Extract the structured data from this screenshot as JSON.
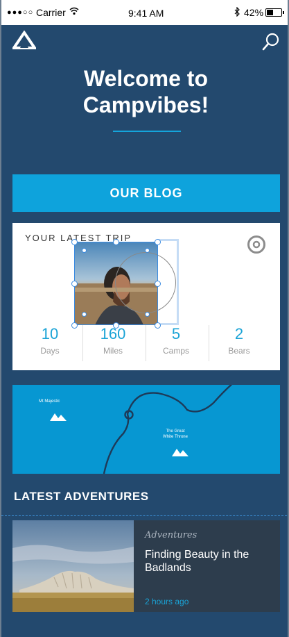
{
  "status_bar": {
    "signal": "●●●○○",
    "carrier": "Carrier",
    "time": "9:41 AM",
    "battery": "42%"
  },
  "header": {
    "logo_icon": "tent-triangle-icon",
    "search_icon": "search-icon"
  },
  "welcome": {
    "line1": "Welcome to",
    "line2": "Campvibes!"
  },
  "blog_button": {
    "label": "OUR BLOG"
  },
  "latest_trip": {
    "title": "YOUR LATEST TRIP",
    "icon": "compass-target-icon",
    "stats": [
      {
        "value": "10",
        "label": "Days"
      },
      {
        "value": "160",
        "label": "Miles"
      },
      {
        "value": "5",
        "label": "Camps"
      },
      {
        "value": "2",
        "label": "Bears"
      }
    ]
  },
  "map": {
    "labels": [
      {
        "text": "Mt Majestic"
      },
      {
        "text": "The Great White Throne"
      }
    ],
    "line2a": "The Great",
    "line2b": "White Throne"
  },
  "latest_adventures": {
    "title": "LATEST ADVENTURES",
    "items": [
      {
        "category": "Adventures",
        "title": "Finding Beauty in the Badlands",
        "time": "2 hours ago"
      }
    ]
  },
  "colors": {
    "background": "#23496e",
    "accent": "#0ea3dc",
    "card_dark": "#2d3d4d"
  }
}
